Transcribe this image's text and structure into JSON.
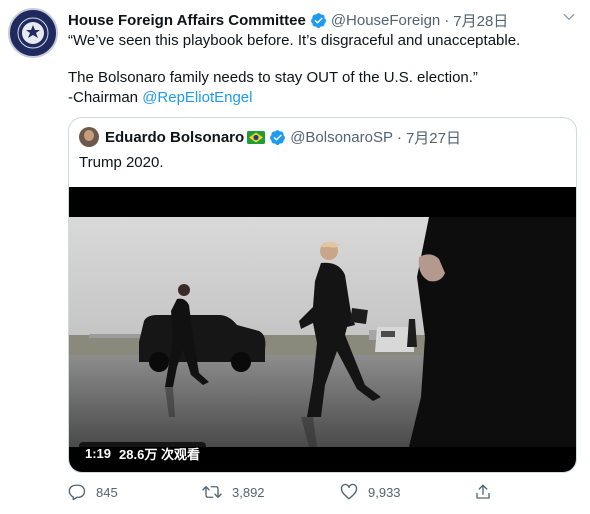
{
  "tweet": {
    "author": {
      "display_name": "House Foreign Affairs Committee",
      "handle": "@HouseForeign",
      "separator": "·",
      "date": "7月28日",
      "verified": true
    },
    "text": {
      "line1": "“We’ve seen this playbook before. It’s disgraceful and unacceptable.",
      "line2": "The Bolsonaro family needs to stay OUT of the U.S. election.”",
      "line3_prefix": "-Chairman ",
      "line3_mention": "@RepEliotEngel"
    },
    "quoted": {
      "display_name": "Eduardo Bolsonaro",
      "handle": "@BolsonaroSP",
      "separator": "·",
      "date": "7月27日",
      "verified": true,
      "flag": "brazil-flag",
      "text": "Trump 2020.",
      "video": {
        "duration": "1:19",
        "views": "28.6万 次观看"
      }
    },
    "actions": {
      "reply_count": "845",
      "retweet_count": "3,892",
      "like_count": "9,933"
    }
  },
  "icons": {
    "more": "chevron-down-icon",
    "reply": "reply-icon",
    "retweet": "retweet-icon",
    "like": "heart-icon",
    "share": "share-icon"
  },
  "colors": {
    "accent": "#1d9bf0",
    "secondary_text": "#536471",
    "verified": "#1d9bf0",
    "border": "#cfd9de"
  }
}
